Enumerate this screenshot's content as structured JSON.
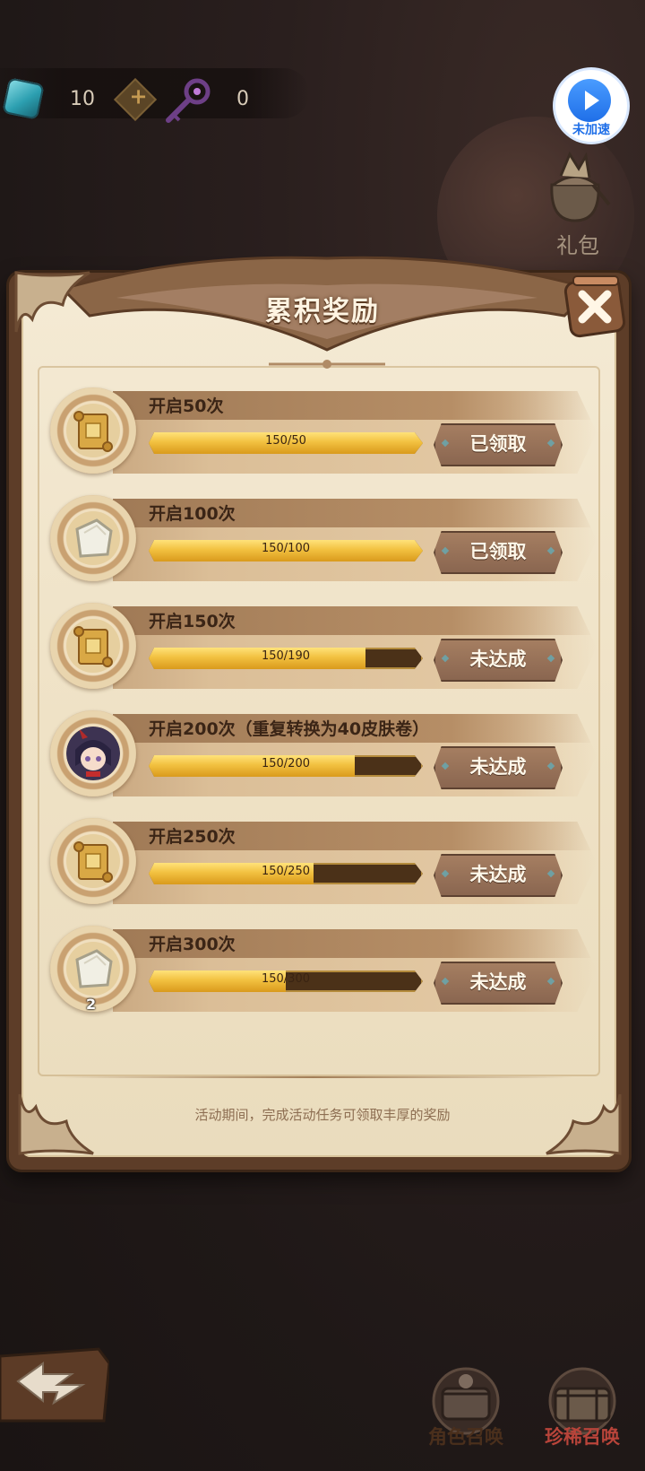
{
  "resources": {
    "gem_count": "10",
    "key_count": "0"
  },
  "speed": {
    "label": "未加速"
  },
  "gift": {
    "label": "礼包"
  },
  "panel": {
    "title": "累积奖励",
    "footer_note": "活动期间，完成活动任务可领取丰厚的奖励",
    "rows": [
      {
        "title": "开启50次",
        "progress_text": "150/50",
        "progress": 1.0,
        "status": "已领取",
        "icon": "scroll-icon",
        "qty": ""
      },
      {
        "title": "开启100次",
        "progress_text": "150/100",
        "progress": 1.0,
        "status": "已领取",
        "icon": "stone-tablet-icon",
        "qty": ""
      },
      {
        "title": "开启150次",
        "progress_text": "150/190",
        "progress": 0.79,
        "status": "未达成",
        "icon": "scroll-icon",
        "qty": ""
      },
      {
        "title": "开启200次（重复转换为40皮肤卷）",
        "progress_text": "150/200",
        "progress": 0.75,
        "status": "未达成",
        "icon": "character-portrait",
        "qty": ""
      },
      {
        "title": "开启250次",
        "progress_text": "150/250",
        "progress": 0.6,
        "status": "未达成",
        "icon": "scroll-icon",
        "qty": ""
      },
      {
        "title": "开启300次",
        "progress_text": "150/300",
        "progress": 0.5,
        "status": "未达成",
        "icon": "stone-tablet-icon",
        "qty": "2"
      }
    ]
  },
  "bottom_nav": {
    "character_summon": "角色召唤",
    "rare_summon": "珍稀召唤"
  },
  "colors": {
    "rare_summon_label": "#b8443a",
    "character_summon_label": "#8c7b6c",
    "progress_fill": "#f2c140"
  }
}
